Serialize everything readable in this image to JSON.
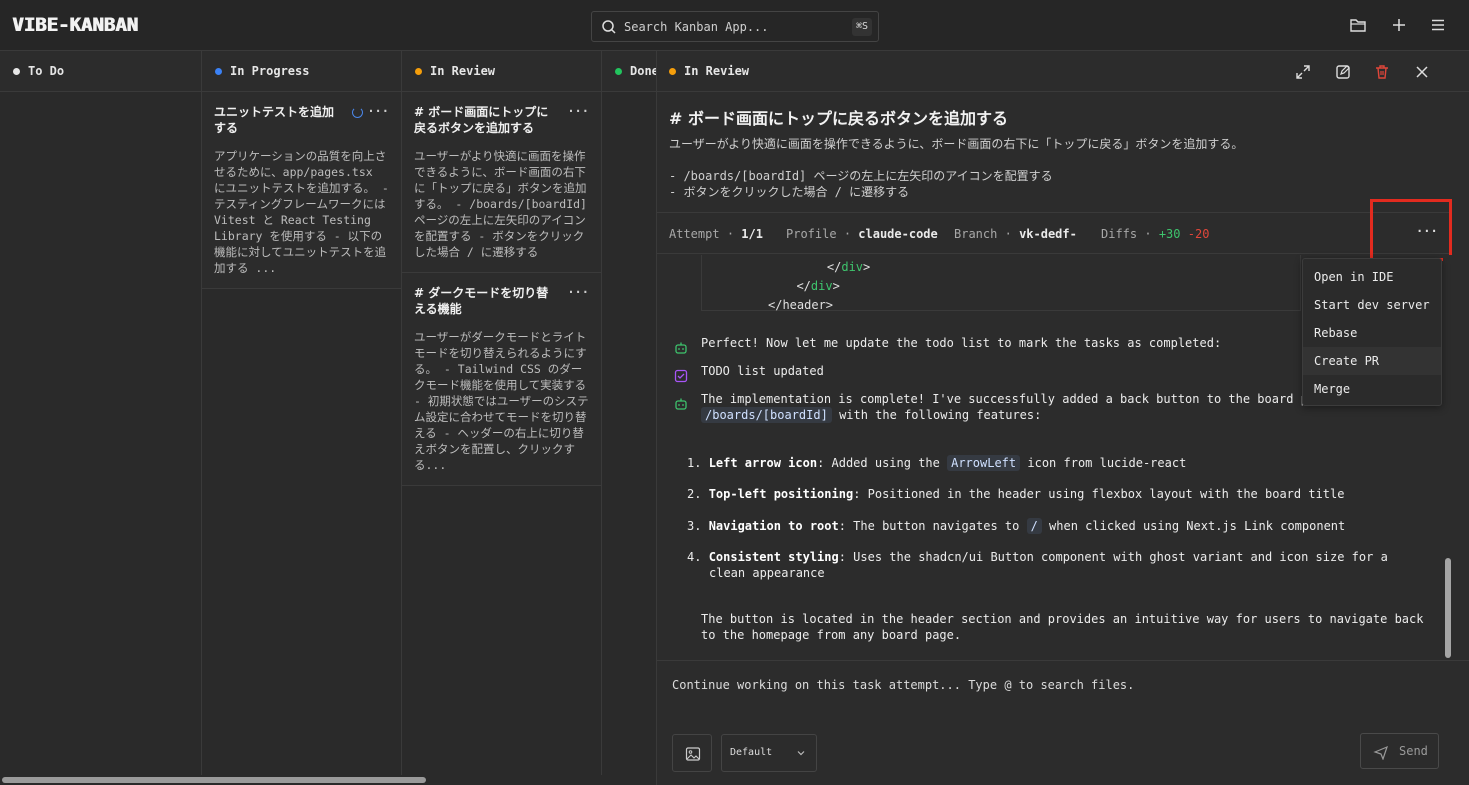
{
  "app": {
    "logo": "VIBE-KANBAN"
  },
  "search": {
    "placeholder": "Search Kanban App...",
    "shortcut": "⌘S"
  },
  "toolbar": {
    "icons": [
      "folder-icon",
      "plus-icon",
      "menu-icon"
    ]
  },
  "columns": [
    {
      "name": "To Do",
      "color": "#e6e6e6",
      "cards": []
    },
    {
      "name": "In Progress",
      "color": "#3b82f6",
      "cards": [
        {
          "title": "ユニットテストを追加する",
          "body": "アプリケーションの品質を向上させるために、app/pages.tsx にユニットテストを追加する。 - テスティングフレームワークには Vitest と React Testing Library を使用する - 以下の機能に対してユニットテストを追加する ..."
        }
      ]
    },
    {
      "name": "In Review",
      "color": "#f59e0b",
      "cards": [
        {
          "title": "# ボード画面にトップに戻るボタンを追加する",
          "body": "ユーザーがより快適に画面を操作できるように、ボード画面の右下に「トップに戻る」ボタンを追加する。 - /boards/[boardId] ページの左上に左矢印のアイコンを配置する - ボタンをクリックした場合 / に遷移する"
        },
        {
          "title": "# ダークモードを切り替える機能",
          "body": "ユーザーがダークモードとライトモードを切り替えられるようにする。 - Tailwind CSS のダークモード機能を使用して実装する - 初期状態ではユーザーのシステム設定に合わせてモードを切り替える - ヘッダーの右上に切り替えボタンを配置し、クリックする..."
        }
      ]
    },
    {
      "name": "Done",
      "color": "#22c55e",
      "cards": []
    }
  ],
  "panel": {
    "status": "In Review",
    "status_color": "#f59e0b",
    "task_title": "# ボード画面にトップに戻るボタンを追加する",
    "task_desc": "ユーザーがより快適に画面を操作できるように、ボード画面の右下に「トップに戻る」ボタンを追加する。",
    "task_items": [
      "- /boards/[boardId] ページの左上に左矢印のアイコンを配置する",
      "- ボタンをクリックした場合 / に遷移する"
    ],
    "attempt": {
      "attempt_label": "Attempt",
      "attempt_value": "1/1",
      "profile_label": "Profile",
      "profile_value": "claude-code",
      "branch_label": "Branch",
      "branch_value": "vk-dedf-",
      "diffs_label": "Diffs",
      "added": "+30",
      "removed": "-20",
      "sep": "·"
    },
    "code_lines": [
      "    </",
      "div",
      ">",
      "  </",
      "div",
      ">",
      "</header>"
    ],
    "messages": {
      "m1": "Perfect! Now let me update the todo list to mark the tasks as completed:",
      "m2": "TODO list updated",
      "m3a": "The implementation is complete! I've successfully added a back button to the board p",
      "m3code": "/boards/[boardId]",
      "m3b": "with the following features:",
      "items": [
        {
          "n": "1.",
          "bold": "Left arrow icon",
          "a": ": Added using the ",
          "code": "ArrowLeft",
          "b": " icon from lucide-react"
        },
        {
          "n": "2.",
          "bold": "Top-left positioning",
          "a": ": Positioned in the header using flexbox layout with the board title",
          "code": "",
          "b": ""
        },
        {
          "n": "3.",
          "bold": "Navigation to root",
          "a": ": The button navigates to ",
          "code": "/",
          "b": " when clicked using Next.js Link component"
        },
        {
          "n": "4.",
          "bold": "Consistent styling",
          "a": ": Uses the shadcn/ui Button component with ghost variant and icon size for a",
          "code": "",
          "b": "",
          "c": "clean appearance"
        }
      ],
      "m4": "The button is located in the header section and provides an intuitive way for users to navigate back to the homepage from any board page."
    },
    "composer": {
      "placeholder": "Continue working on this task attempt... Type @ to search files.",
      "profile": "Default",
      "send": "Send"
    },
    "menu": [
      "Open in IDE",
      "Start dev server",
      "Rebase",
      "Create PR",
      "Merge"
    ]
  }
}
